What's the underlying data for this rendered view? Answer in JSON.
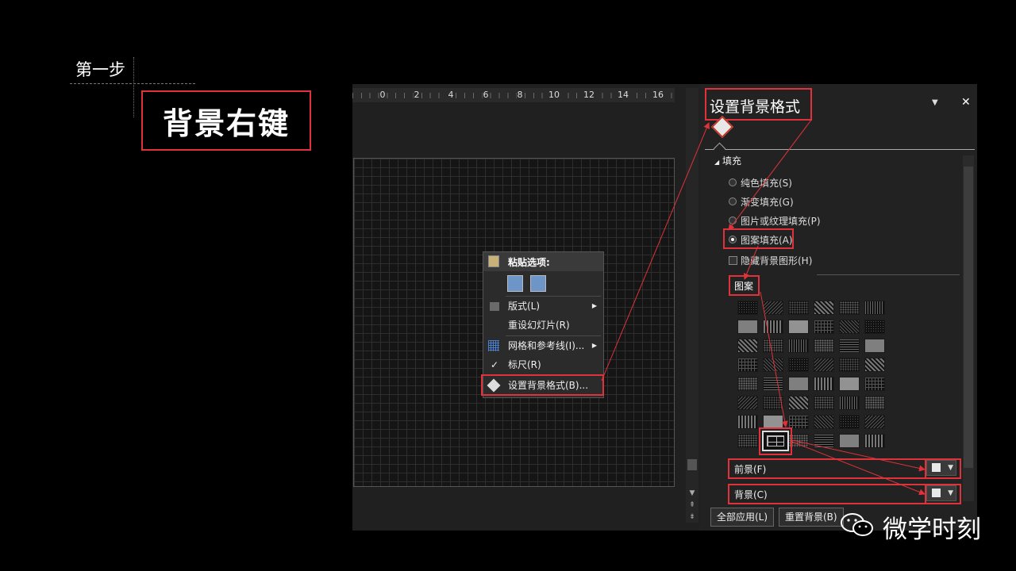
{
  "step": {
    "label": "第一步",
    "title": "背景右键"
  },
  "ruler": {
    "numbers": [
      "0",
      "2",
      "4",
      "6",
      "8",
      "10",
      "12",
      "14",
      "16"
    ]
  },
  "context_menu": {
    "paste_header": "粘贴选项:",
    "items": [
      {
        "label": "版式(L)",
        "icon": "layout-icon",
        "submenu": true
      },
      {
        "label": "重设幻灯片(R)",
        "icon": "",
        "submenu": false
      },
      {
        "label": "网格和参考线(I)...",
        "icon": "grid-icon",
        "submenu": true
      },
      {
        "label": "标尺(R)",
        "icon": "checkmark-icon",
        "submenu": false
      },
      {
        "label": "设置背景格式(B)...",
        "icon": "format-background-icon",
        "submenu": false
      }
    ]
  },
  "pane": {
    "title": "设置背景格式",
    "section": "填充",
    "fill_options": [
      {
        "label": "纯色填充(S)",
        "selected": false
      },
      {
        "label": "渐变填充(G)",
        "selected": false
      },
      {
        "label": "图片或纹理填充(P)",
        "selected": false
      },
      {
        "label": "图案填充(A)",
        "selected": true
      }
    ],
    "hide_bg_graphics": {
      "label": "隐藏背景图形(H)",
      "checked": false
    },
    "pattern_label": "图案",
    "foreground_label": "前景(F)",
    "background_label": "背景(C)",
    "apply_all_label": "全部应用(L)",
    "reset_label": "重置背景(B)"
  },
  "watermark": {
    "text": "微学时刻"
  },
  "colors": {
    "accent": "#e0323a",
    "background": "#000000",
    "panel": "#222222"
  }
}
